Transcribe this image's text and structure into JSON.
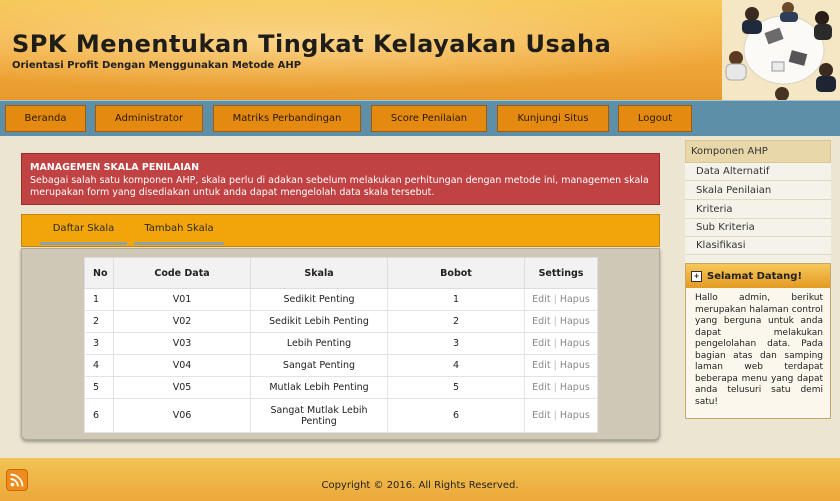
{
  "header": {
    "title": "SPK Menentukan Tingkat Kelayakan Usaha",
    "subtitle": "Orientasi Profit Dengan Menggunakan Metode AHP"
  },
  "nav": [
    "Beranda",
    "Administrator",
    "Matriks Perbandingan",
    "Score Penilaian",
    "Kunjungi Situs",
    "Logout"
  ],
  "alert": {
    "title": "MANAGEMEN SKALA PENILAIAN",
    "text": "Sebagai salah satu komponen AHP, skala perlu di adakan sebelum melakukan perhitungan dengan metode ini, managemen skala merupakan form yang disediakan untuk anda dapat mengelolah data skala tersebut."
  },
  "tabs": [
    "Daftar Skala",
    "Tambah Skala"
  ],
  "table": {
    "headers": [
      "No",
      "Code Data",
      "Skala",
      "Bobot",
      "Settings"
    ],
    "rows": [
      {
        "no": "1",
        "code": "V01",
        "skala": "Sedikit Penting",
        "bobot": "1"
      },
      {
        "no": "2",
        "code": "V02",
        "skala": "Sedikit Lebih Penting",
        "bobot": "2"
      },
      {
        "no": "3",
        "code": "V03",
        "skala": "Lebih Penting",
        "bobot": "3"
      },
      {
        "no": "4",
        "code": "V04",
        "skala": "Sangat Penting",
        "bobot": "4"
      },
      {
        "no": "5",
        "code": "V05",
        "skala": "Mutlak Lebih Penting",
        "bobot": "5"
      },
      {
        "no": "6",
        "code": "V06",
        "skala": "Sangat Mutlak Lebih Penting",
        "bobot": "6"
      }
    ],
    "edit_label": "Edit",
    "separator": "|",
    "delete_label": "Hapus"
  },
  "sidebar": {
    "heading": "Komponen AHP",
    "items": [
      "Data Alternatif",
      "Skala Penilaian",
      "Kriteria",
      "Sub Kriteria",
      "Klasifikasi"
    ]
  },
  "welcome": {
    "title": "Selamat Datang!",
    "text": "Hallo admin, berikut merupakan halaman control yang berguna untuk anda dapat melakukan pengelolahan data. Pada bagian atas dan samping laman web terdapat beberapa menu yang dapat anda telusuri satu demi satu!"
  },
  "footer": {
    "copyright": "Copyright © 2016. All Rights Reserved."
  },
  "icons": {
    "header_image": "people-at-table-image",
    "welcome": "expand-icon",
    "rss": "rss-icon"
  },
  "colors": {
    "nav_button": "#e58a10",
    "alert": "#c04243",
    "tab_bar": "#f2a50b",
    "nav_bar": "#5e8fa9"
  }
}
